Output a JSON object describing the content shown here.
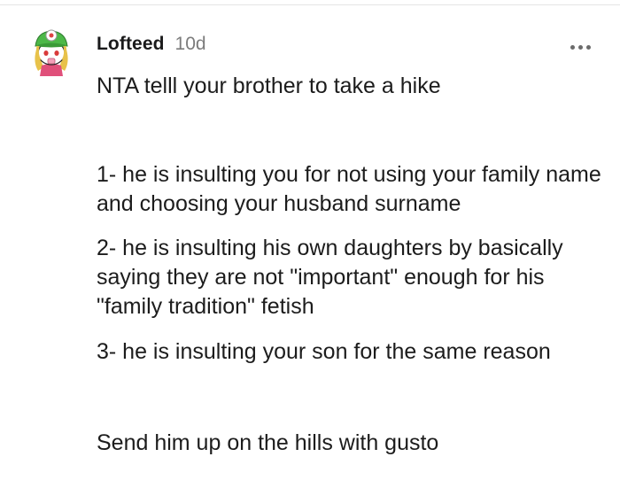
{
  "comment": {
    "username": "Lofteed",
    "timestamp": "10d",
    "more_icon": "more-horizontal-icon",
    "avatar_icon": "snoo-avatar-icon",
    "paragraphs": [
      "NTA telll your brother to take a hike",
      "1- he is insulting you for not using your family name and choosing your husband surname",
      "2- he is insulting his own daughters by basically saying they are not \"important\" enough for his \"family tradition\" fetish",
      "3- he is insulting your son for the same reason",
      "Send him up on the hills with gusto"
    ]
  }
}
